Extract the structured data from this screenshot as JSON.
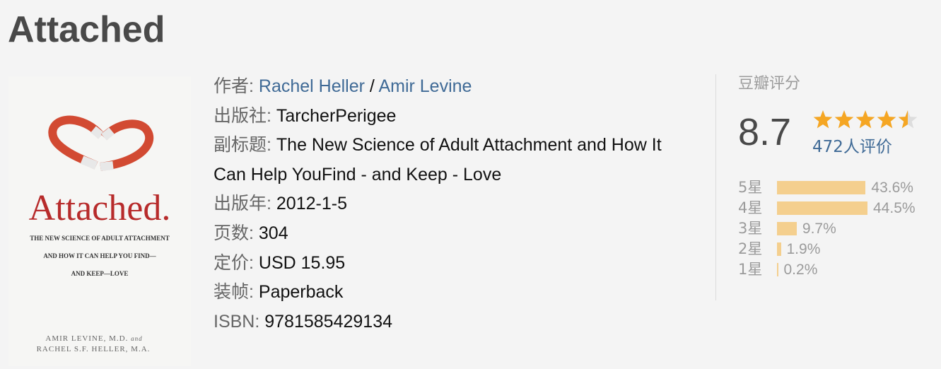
{
  "title": "Attached",
  "cover": {
    "title": "Attached.",
    "subtitle_lines": [
      "THE NEW SCIENCE OF ADULT ATTACHMENT",
      "AND HOW IT CAN HELP YOU FIND—",
      "AND KEEP—LOVE"
    ],
    "author_line1": "AMIR LEVINE, M.D.",
    "author_and": "and",
    "author_line2": "RACHEL S.F. HELLER, M.A."
  },
  "info": {
    "author_label": "作者:",
    "authors": [
      "Rachel Heller",
      "Amir Levine"
    ],
    "author_sep": " / ",
    "publisher_label": "出版社:",
    "publisher": "TarcherPerigee",
    "subtitle_label": "副标题:",
    "subtitle": "The New Science of Adult Attachment and How It Can Help YouFind - and Keep - Love",
    "pubyear_label": "出版年:",
    "pubyear": "2012-1-5",
    "pages_label": "页数:",
    "pages": "304",
    "price_label": "定价:",
    "price": "USD 15.95",
    "binding_label": "装帧:",
    "binding": "Paperback",
    "isbn_label": "ISBN:",
    "isbn": "9781585429134"
  },
  "rating": {
    "title": "豆瓣评分",
    "score": "8.7",
    "stars_value": 4.5,
    "count": "472人评价",
    "distribution": [
      {
        "star": "5星",
        "percent": 43.6,
        "label": "43.6%"
      },
      {
        "star": "4星",
        "percent": 44.5,
        "label": "44.5%"
      },
      {
        "star": "3星",
        "percent": 9.7,
        "label": "9.7%"
      },
      {
        "star": "2星",
        "percent": 1.9,
        "label": "1.9%"
      },
      {
        "star": "1星",
        "percent": 0.2,
        "label": "0.2%"
      }
    ],
    "colors": {
      "bar": "#f4cf8e",
      "star_filled": "#f5a623",
      "star_empty": "#dddddd",
      "link": "#3f6a96"
    }
  }
}
